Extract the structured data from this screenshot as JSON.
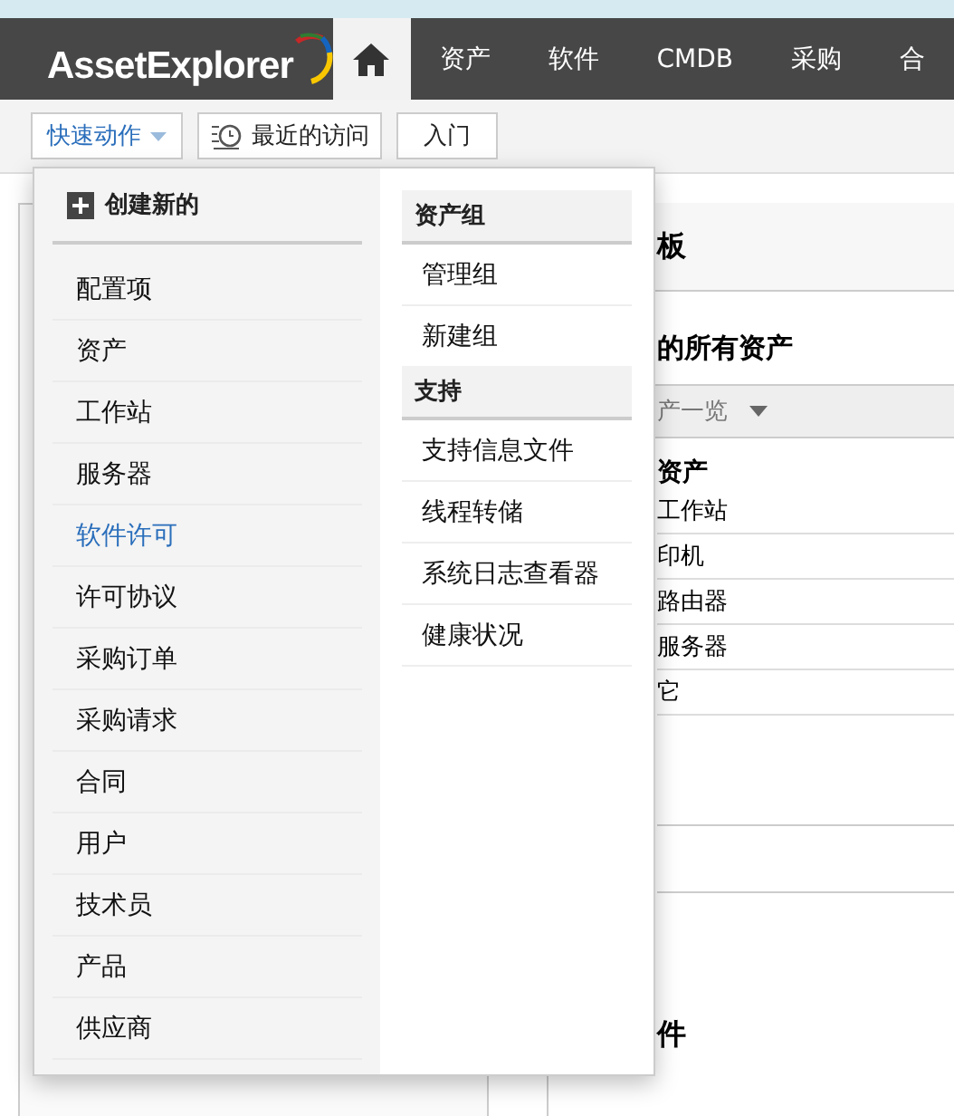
{
  "logo": "AssetExplorer",
  "nav": [
    {
      "label": "资产",
      "selected": false
    },
    {
      "label": "软件",
      "selected": false
    },
    {
      "label": "CMDB",
      "selected": false
    },
    {
      "label": "采购",
      "selected": false
    },
    {
      "label": "合",
      "selected": false
    }
  ],
  "home_selected": true,
  "toolbar": {
    "quick_actions": "快速动作",
    "recent": "最近的访问",
    "getting_started": "入门"
  },
  "quick_menu": {
    "create_heading": "创建新的",
    "create_items": [
      {
        "label": "配置项",
        "selected": false
      },
      {
        "label": "资产",
        "selected": false
      },
      {
        "label": "工作站",
        "selected": false
      },
      {
        "label": "服务器",
        "selected": false
      },
      {
        "label": "软件许可",
        "selected": true
      },
      {
        "label": "许可协议",
        "selected": false
      },
      {
        "label": "采购订单",
        "selected": false
      },
      {
        "label": "采购请求",
        "selected": false
      },
      {
        "label": "合同",
        "selected": false
      },
      {
        "label": "用户",
        "selected": false
      },
      {
        "label": "技术员",
        "selected": false
      },
      {
        "label": "产品",
        "selected": false
      },
      {
        "label": "供应商",
        "selected": false
      }
    ],
    "sections": [
      {
        "heading": "资产组",
        "items": [
          "管理组",
          "新建组"
        ]
      },
      {
        "heading": "支持",
        "items": [
          "支持信息文件",
          "线程转储",
          "系统日志查看器",
          "健康状况"
        ]
      }
    ]
  },
  "dashboard": {
    "title": "板",
    "widget_title": "的所有资产",
    "view_select": "产一览",
    "list_heading": "资产",
    "rows": [
      "工作站",
      "印机",
      "路由器",
      "服务器",
      "它"
    ],
    "second_widget_title": "件"
  }
}
